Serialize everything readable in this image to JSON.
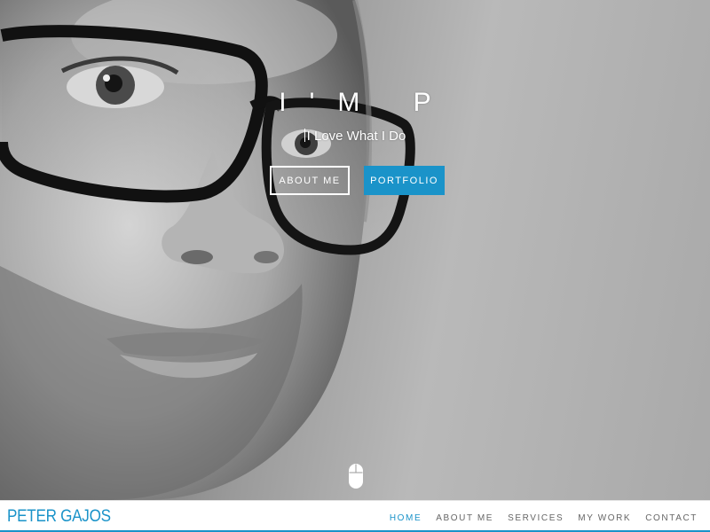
{
  "hero": {
    "title": "I'M P",
    "subtitle": "I Love What I Do",
    "buttons": {
      "about_label": "ABOUT ME",
      "portfolio_label": "PORTFOLIO"
    }
  },
  "scroll_icon": "mouse-icon",
  "navbar": {
    "brand": "PETER GAJOS",
    "links": [
      {
        "label": "HOME",
        "active": true
      },
      {
        "label": "ABOUT ME",
        "active": false
      },
      {
        "label": "SERVICES",
        "active": false
      },
      {
        "label": "MY WORK",
        "active": false
      },
      {
        "label": "CONTACT",
        "active": false
      }
    ]
  },
  "colors": {
    "accent": "#1a93c9",
    "nav_text": "#666666",
    "white": "#ffffff"
  }
}
